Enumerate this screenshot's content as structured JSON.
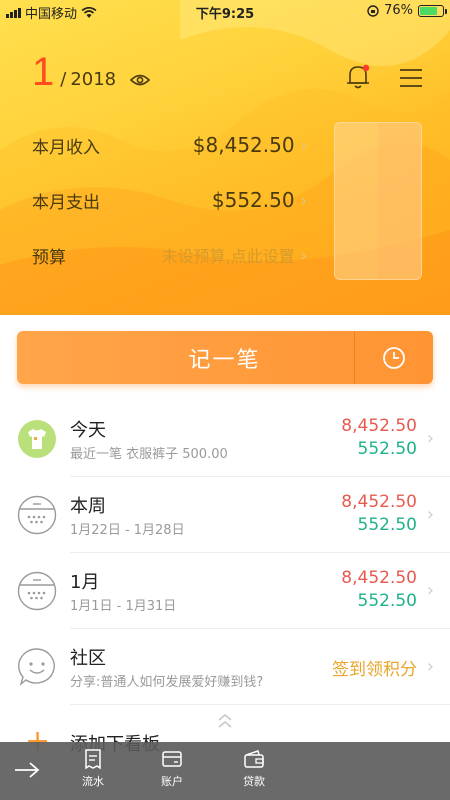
{
  "status_bar": {
    "carrier": "中国移动",
    "time": "下午9:25",
    "battery": "76%",
    "battery_level": 0.76
  },
  "header": {
    "month": "1",
    "year": "2018",
    "income_label": "本月收入",
    "income_value": "$8,452.50",
    "expense_label": "本月支出",
    "expense_value": "$552.50",
    "budget_label": "预算",
    "budget_hint": "未设预算,点此设置"
  },
  "record_button": {
    "label": "记一笔"
  },
  "rows": {
    "today": {
      "title": "今天",
      "subtitle": "最近一笔 衣服裤子 500.00",
      "income": "8,452.50",
      "expense": "552.50"
    },
    "week": {
      "title": "本周",
      "subtitle": "1月22日 - 1月28日",
      "income": "8,452.50",
      "expense": "552.50"
    },
    "month": {
      "title": "1月",
      "subtitle": "1月1日 - 1月31日",
      "income": "8,452.50",
      "expense": "552.50"
    },
    "community": {
      "title": "社区",
      "subtitle": "分享:普通人如何发展爱好赚到钱?",
      "action": "签到领积分"
    },
    "add": {
      "title": "添加下看板"
    }
  },
  "tabbar": {
    "flow": "流水",
    "account": "账户",
    "loan": "贷款"
  },
  "colors": {
    "accent_orange": "#ff9433",
    "income_red": "#e85a4f",
    "expense_green": "#1fb18a",
    "month_red": "#ff4b1f"
  }
}
